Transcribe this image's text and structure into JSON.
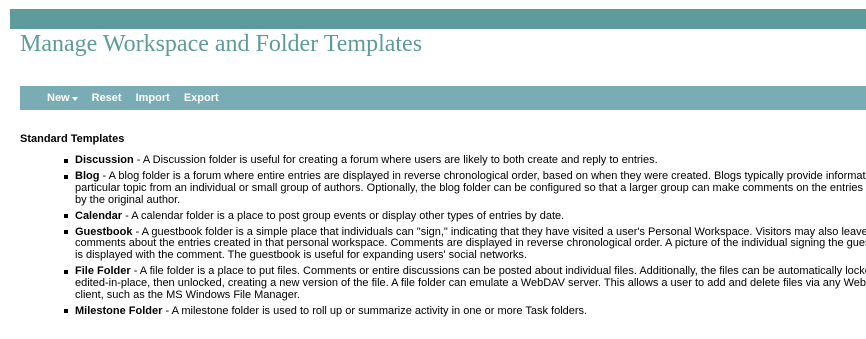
{
  "page": {
    "title": "Manage Workspace and Folder Templates"
  },
  "toolbar": {
    "new_label": "New",
    "reset_label": "Reset",
    "import_label": "Import",
    "export_label": "Export"
  },
  "section": {
    "heading": "Standard Templates"
  },
  "templates": [
    {
      "name": "Discussion",
      "lines": [
        "- A Discussion folder is useful for creating a forum where users are likely to both create and reply to entries."
      ]
    },
    {
      "name": "Blog",
      "lines": [
        "- A blog folder is a forum where entire entries are displayed in reverse chronological order, based on when they were created. Blogs typically provide information on a",
        "particular topic from an individual or small group of authors. Optionally, the blog folder can be configured so that a larger group can make comments on the entries posted",
        "by the original author."
      ]
    },
    {
      "name": "Calendar",
      "lines": [
        "- A calendar folder is a place to post group events or display other types of entries by date."
      ]
    },
    {
      "name": "Guestbook",
      "lines": [
        "- A guestbook folder is a simple place that individuals can \"sign,\" indicating that they have visited a user's Personal Workspace. Visitors may also leave",
        "comments about the entries created in that personal workspace. Comments are displayed in reverse chronological order. A picture of the individual signing the guestbook",
        "is displayed with the comment. The guestbook is useful for expanding users' social networks."
      ]
    },
    {
      "name": "File Folder",
      "lines": [
        "- A file folder is a place to put files. Comments or entire discussions can be posted about individual files. Additionally, the files can be automatically locked,",
        "edited-in-place, then unlocked, creating a new version of the file. A file folder can emulate a WebDAV server. This allows a user to add and delete files via any WebDAV",
        "client, such as the MS Windows File Manager."
      ]
    },
    {
      "name": "Milestone Folder",
      "lines": [
        "- A milestone folder is used to roll up or summarize activity in one or more Task folders."
      ]
    }
  ],
  "colors": {
    "top_bar": "#5e9c9c",
    "title": "#5e9c9c",
    "toolbar": "#79acb4"
  }
}
